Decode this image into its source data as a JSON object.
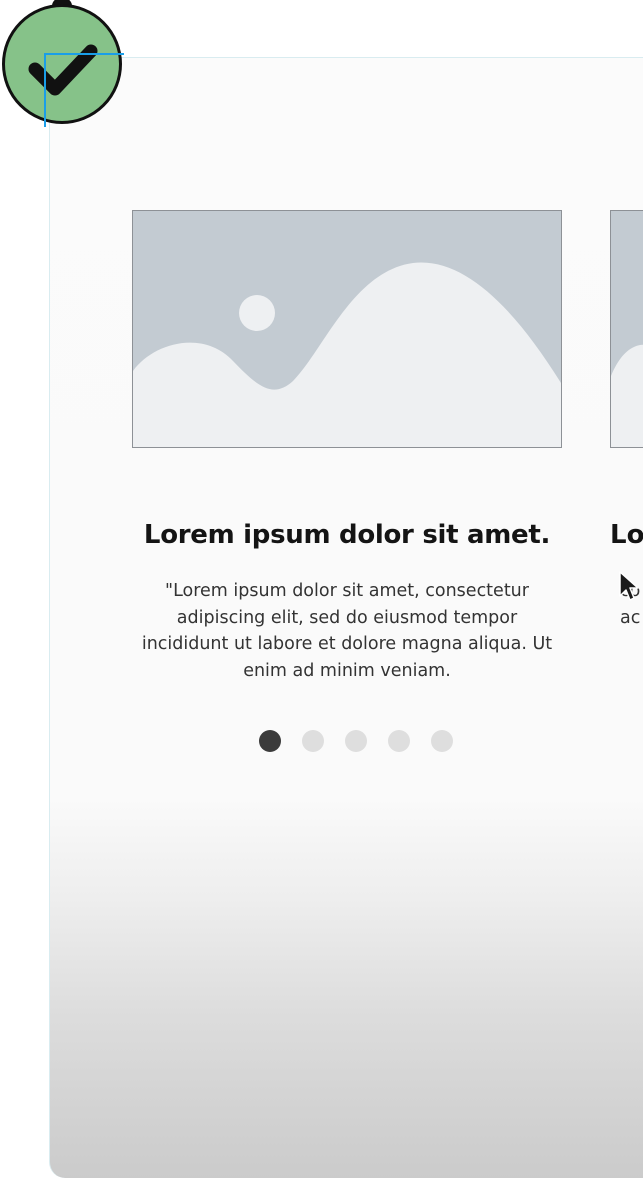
{
  "carousel": {
    "slides": [
      {
        "title": "Lorem ipsum dolor sit amet.",
        "body": "\"Lorem ipsum dolor sit amet, consectetur adipiscing elit, sed do eiusmod tempor incididunt ut labore et dolore magna aliqua. Ut enim ad minim veniam."
      },
      {
        "title": "Lo",
        "body_line1": "co",
        "body_line2": "ac"
      }
    ],
    "pagination": {
      "total": 5,
      "active_index": 0
    }
  },
  "icons": {
    "status": "check-icon",
    "placeholder": "image-placeholder-icon",
    "pointer": "mouse-cursor-icon"
  },
  "colors": {
    "badge": "#86c289",
    "selection": "#1a9ee8",
    "placeholder_bg": "#c3cbd2",
    "placeholder_fg": "#eef0f2",
    "dot_active": "#3b3b3b",
    "dot_inactive": "#dedede"
  }
}
